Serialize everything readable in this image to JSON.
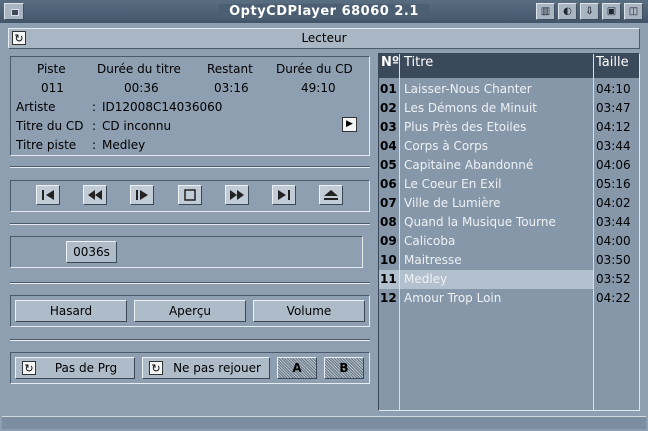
{
  "window": {
    "title": "OptyCDPlayer 68060  2.1",
    "section_title": "Lecteur"
  },
  "colors": {
    "title_bar": "#4b5e72",
    "window_bg": "#8d9fb1",
    "list_header": "#3b4a5b",
    "list_selected": "#b3c1cf"
  },
  "icons": {
    "close": "close-icon",
    "cycle": "cycle-icon",
    "next": "arrow-right-icon"
  },
  "info": {
    "headers": [
      "Piste",
      "Durée du titre",
      "Restant",
      "Durée du CD"
    ],
    "values": [
      "011",
      "00:36",
      "03:16",
      "49:10"
    ],
    "artist_label": "Artiste",
    "artist_value": "ID12008C14036060",
    "cd_title_label": "Titre du CD",
    "cd_title_value": "CD inconnu",
    "track_title_label": "Titre piste",
    "track_title_value": "Medley",
    "sep": ":"
  },
  "transport": [
    "first-track",
    "rewind",
    "play-pause",
    "stop",
    "fast-forward",
    "last-track",
    "eject"
  ],
  "position": {
    "label": "0036s",
    "seconds": 36
  },
  "controls": {
    "random": "Hasard",
    "preview": "Aperçu",
    "volume": "Volume"
  },
  "program": {
    "prg": "Pas de Prg",
    "repeat": "Ne pas rejouer",
    "a": "A",
    "b": "B"
  },
  "tracklist": {
    "headers": {
      "num": "Nº",
      "title": "Titre",
      "size": "Taille"
    },
    "selected_index": 10,
    "rows": [
      {
        "num": "01",
        "title": "Laisser-Nous Chanter",
        "size": "04:10"
      },
      {
        "num": "02",
        "title": "Les Démons de Minuit",
        "size": "03:47"
      },
      {
        "num": "03",
        "title": "Plus Près des Etoiles",
        "size": "04:12"
      },
      {
        "num": "04",
        "title": "Corps à Corps",
        "size": "03:44"
      },
      {
        "num": "05",
        "title": "Capitaine Abandonné",
        "size": "04:06"
      },
      {
        "num": "06",
        "title": "Le Coeur En Exil",
        "size": "05:16"
      },
      {
        "num": "07",
        "title": "Ville de Lumière",
        "size": "04:02"
      },
      {
        "num": "08",
        "title": "Quand la Musique Tourne",
        "size": "03:44"
      },
      {
        "num": "09",
        "title": "Calicoba",
        "size": "04:00"
      },
      {
        "num": "10",
        "title": "Maitresse",
        "size": "03:50"
      },
      {
        "num": "11",
        "title": "Medley",
        "size": "03:52"
      },
      {
        "num": "12",
        "title": "Amour Trop Loin",
        "size": "04:22"
      }
    ]
  }
}
